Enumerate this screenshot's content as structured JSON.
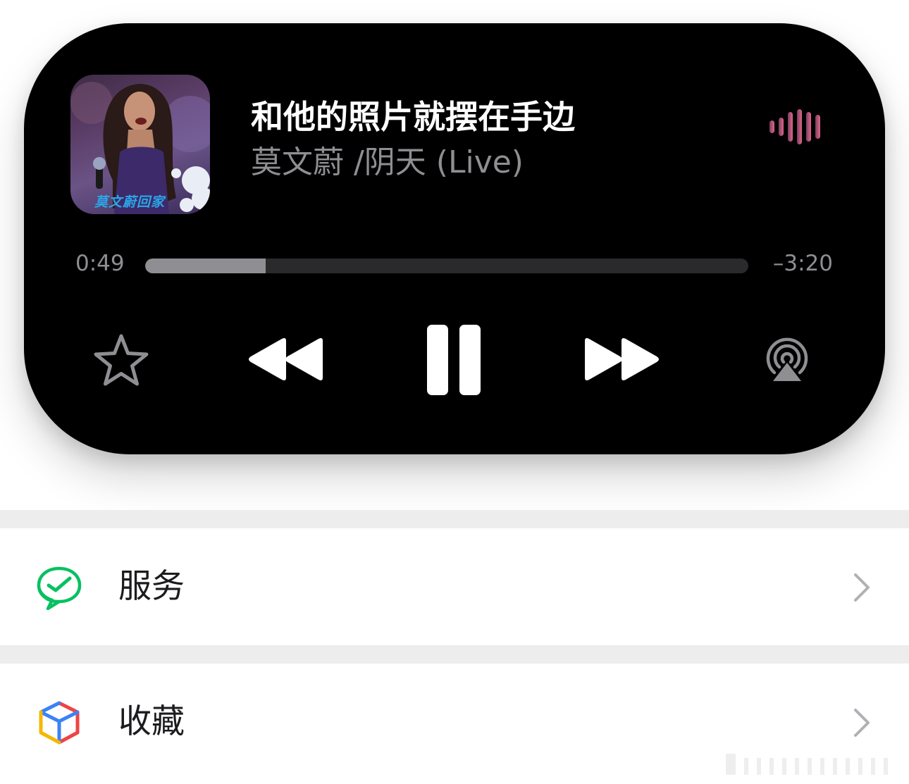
{
  "now_playing": {
    "title": "和他的照片就摆在手边",
    "subtitle": "莫文蔚 /阴天 (Live)",
    "artwork_logo_text": "莫文蔚回家",
    "elapsed": "0:49",
    "remaining": "–3:20",
    "progress_fraction": 0.2,
    "controls": {
      "favorite_icon": "star-icon",
      "rewind_icon": "backward-icon",
      "play_pause_icon": "pause-icon",
      "forward_icon": "forward-icon",
      "airplay_icon": "airplay-audio-icon"
    },
    "accent_colors": {
      "waveform_start": "#8a4a6a",
      "waveform_end": "#d85a78"
    }
  },
  "menu": {
    "items": [
      {
        "label": "服务",
        "icon": "services-check-icon",
        "icon_color": "#07c160"
      },
      {
        "label": "收藏",
        "icon": "favorites-cube-icon",
        "icon_colors": [
          "#3b82f6",
          "#ef4444",
          "#f5b700"
        ]
      }
    ]
  }
}
